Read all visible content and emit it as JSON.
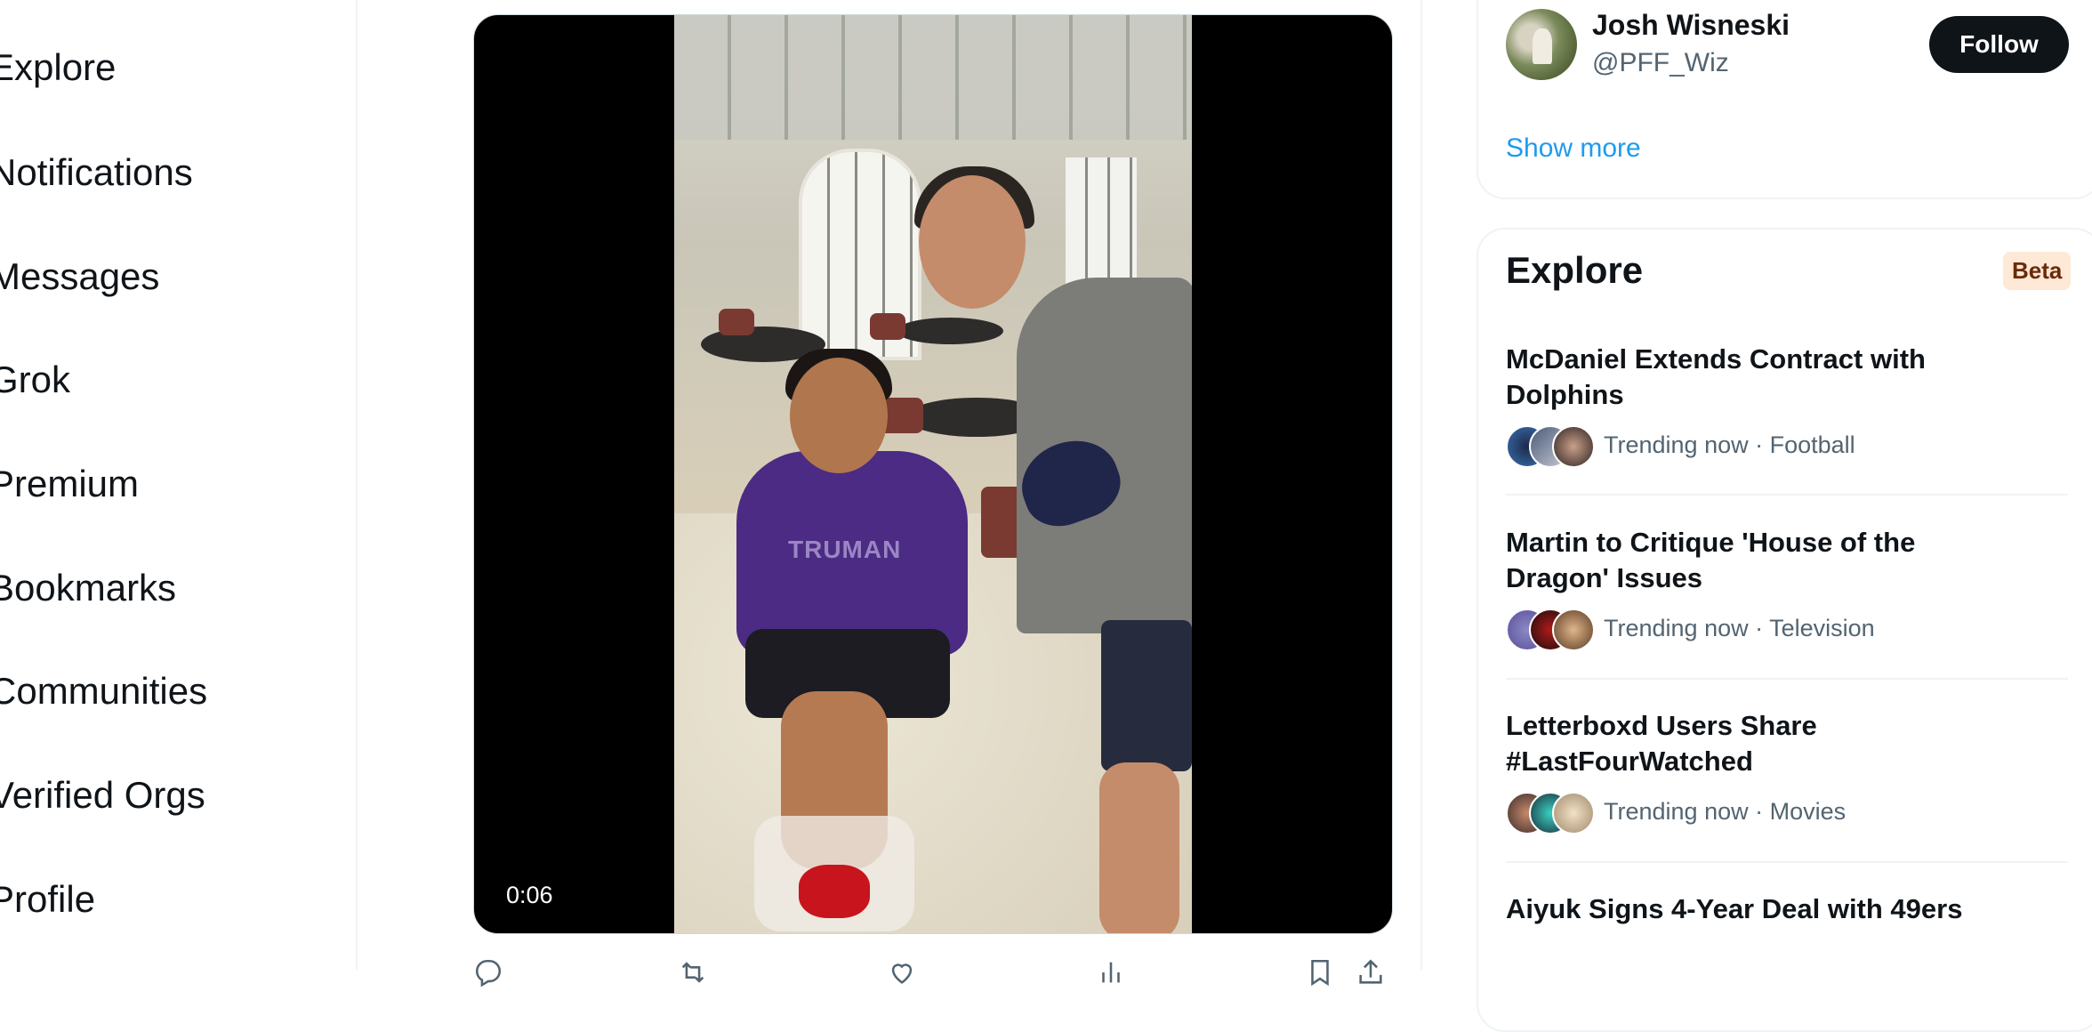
{
  "left_nav": {
    "items": [
      {
        "label": "Explore"
      },
      {
        "label": "Notifications"
      },
      {
        "label": "Messages"
      },
      {
        "label": "Grok"
      },
      {
        "label": "Premium"
      },
      {
        "label": "Bookmarks"
      },
      {
        "label": "Communities"
      },
      {
        "label": "Verified Orgs"
      },
      {
        "label": "Profile"
      }
    ]
  },
  "video": {
    "timestamp": "0:06",
    "shirt_text": "TRUMAN"
  },
  "tweet_actions": {
    "replies": "",
    "reposts": "",
    "likes": "",
    "views": ""
  },
  "who_to_follow": {
    "name": "Josh Wisneski",
    "handle": "@PFF_Wiz",
    "follow_label": "Follow",
    "show_more_label": "Show more"
  },
  "explore": {
    "title": "Explore",
    "badge": "Beta",
    "trends": [
      {
        "title": "McDaniel Extends Contract with Dolphins",
        "meta": "Trending now · Football"
      },
      {
        "title": "Martin to Critique 'House of the Dragon' Issues",
        "meta": "Trending now · Television"
      },
      {
        "title": "Letterboxd Users Share #LastFourWatched",
        "meta": "Trending now · Movies"
      },
      {
        "title": "Aiyuk Signs 4-Year Deal with 49ers",
        "meta": ""
      }
    ]
  },
  "colors": {
    "accent": "#1d9bf0",
    "text_primary": "#0f1419",
    "text_secondary": "#536471",
    "beta_bg": "#fde9d6",
    "beta_text": "#6b2a0a"
  }
}
